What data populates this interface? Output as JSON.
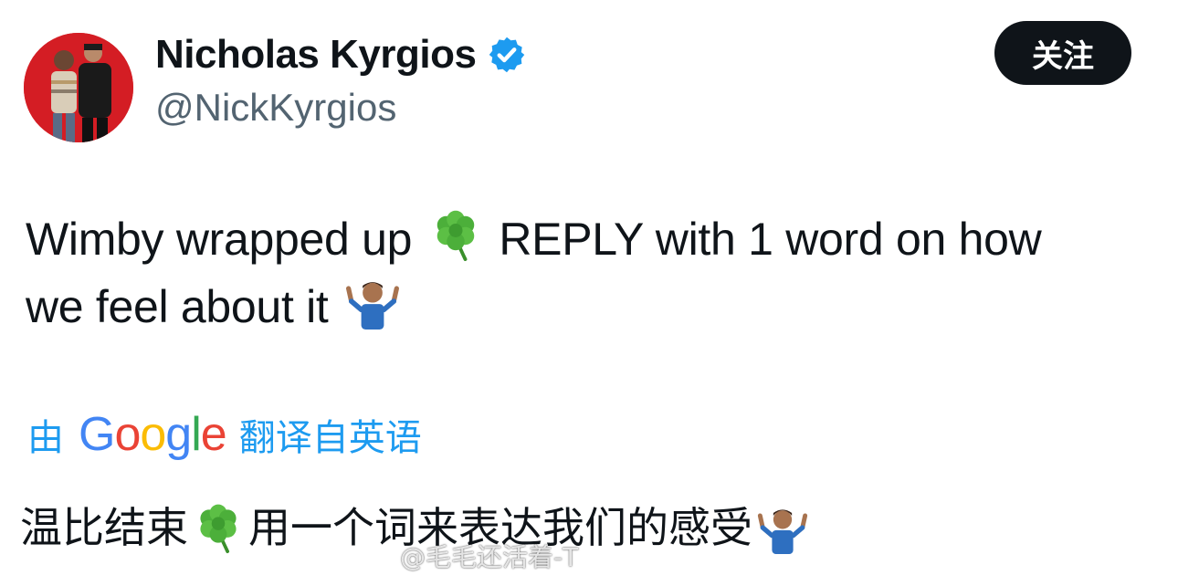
{
  "author": {
    "display_name": "Nicholas Kyrgios",
    "handle": "@NickKyrgios",
    "verified": true,
    "avatar_icon": "profile-photo"
  },
  "follow_button": {
    "label": "关注"
  },
  "tweet": {
    "line1_part1": "Wimby wrapped up",
    "line1_emoji": "shamrock-emoji",
    "line1_part2": "REPLY with 1 word on how",
    "line2_part1": "we feel about it",
    "line2_emoji": "shrugging-man-emoji"
  },
  "translation": {
    "by": "由",
    "provider_letters": [
      "G",
      "o",
      "o",
      "g",
      "l",
      "e"
    ],
    "provider_colors": [
      "#4285f4",
      "#ea4335",
      "#fbbc05",
      "#4285f4",
      "#34a853",
      "#ea4335"
    ],
    "link_text": "翻译自英语",
    "text_part1": "温比结束",
    "text_part2": "用一个词来表达我们的感受"
  },
  "watermark": {
    "text": "@毛毛还活着-T"
  },
  "colors": {
    "link": "#1d9bf0",
    "verified": "#1d9bf0",
    "button_bg": "#0f1419",
    "handle": "#536471"
  }
}
